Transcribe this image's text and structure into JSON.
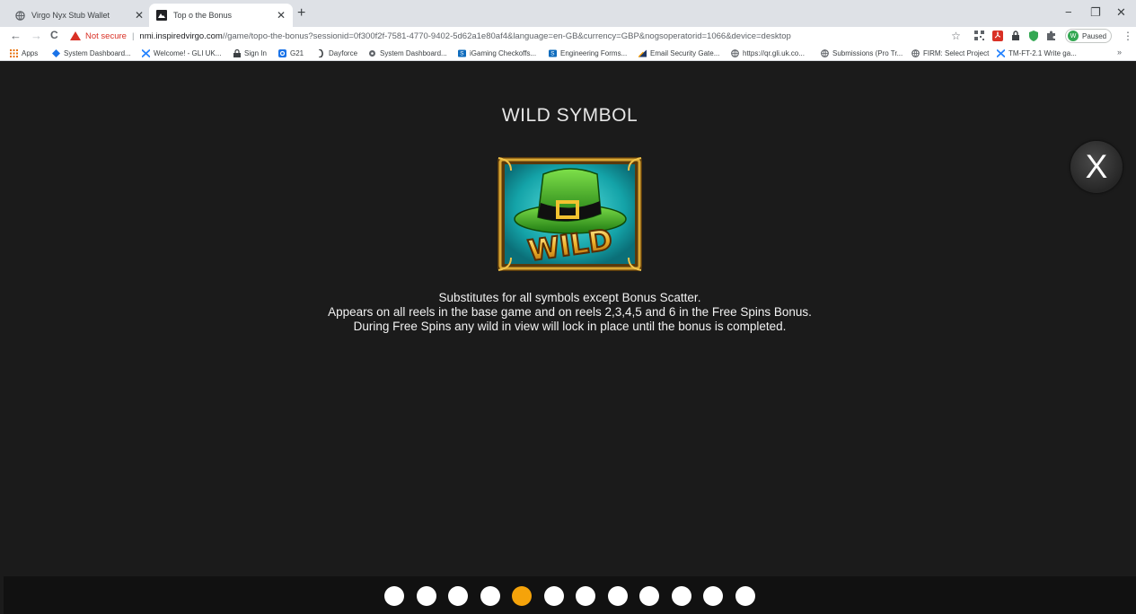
{
  "browser": {
    "tabs": [
      {
        "title": "Virgo Nyx Stub Wallet",
        "active": false
      },
      {
        "title": "Top o the Bonus",
        "active": true
      }
    ],
    "new_tab": "+",
    "window_controls": {
      "minimize": "−",
      "restore": "❐",
      "close": "✕"
    },
    "nav": {
      "back": "←",
      "forward": "→",
      "reload": "C"
    },
    "security_label": "Not secure",
    "separator": "|",
    "url_host": "nmi.inspiredvirgo.com",
    "url_path": "//game/topo-the-bonus?sessionid=0f300f2f-7581-4770-9402-5d62a1e80af4&language=en-GB&currency=GBP&nogsoperatorid=1066&device=desktop",
    "star_icon": "☆",
    "profile": {
      "initial": "W",
      "label": "Paused"
    },
    "menu": "⋮",
    "bookmarks": [
      "Apps",
      "System Dashboard...",
      "Welcome! - GLI UK...",
      "Sign In",
      "G21",
      "Dayforce",
      "System Dashboard...",
      "iGaming Checkoffs...",
      "Engineering Forms...",
      "Email Security Gate...",
      "https://qr.gli.uk.co...",
      "Submissions (Pro Tr...",
      "FIRM: Select Project",
      "TM-FT-2.1 Write ga..."
    ],
    "bookmarks_more": "»"
  },
  "help_page": {
    "title": "WILD SYMBOL",
    "close_label": "X",
    "symbol_text": "WILD",
    "description": [
      "Substitutes for all symbols except Bonus Scatter.",
      "Appears on all reels in the base game and on reels 2,3,4,5 and 6 in the Free Spins Bonus.",
      "During Free Spins any wild in view will lock in place until the bonus is completed."
    ]
  },
  "pagination": {
    "total_pages": 12,
    "current_page": 5
  },
  "colors": {
    "background": "#1b1b1b",
    "active_dot": "#f5a30a",
    "inactive_dot": "#ffffff",
    "not_secure": "#d93025"
  }
}
